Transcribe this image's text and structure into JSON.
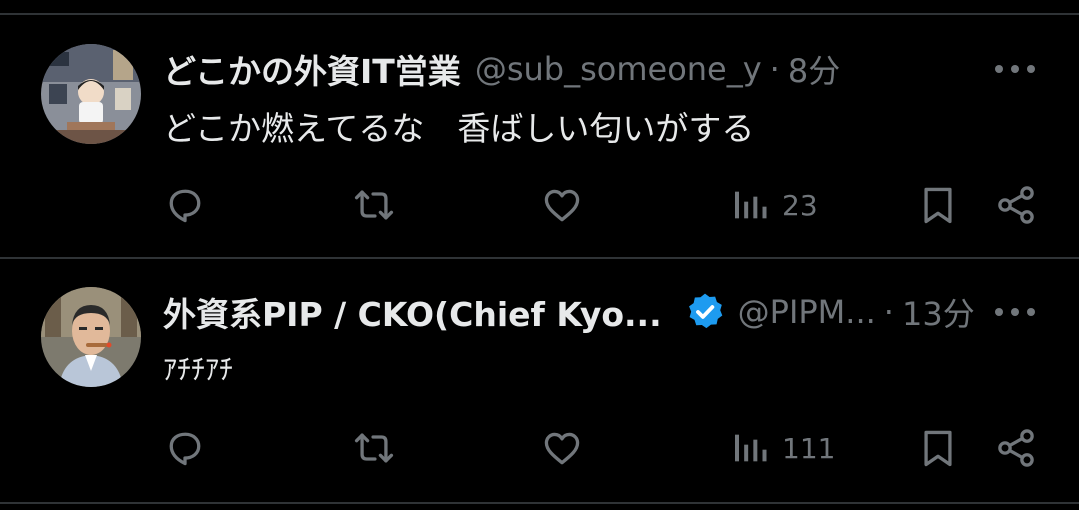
{
  "tweets": [
    {
      "display_name": "どこかの外資IT営業",
      "handle": "@sub_someone_y",
      "separator": "·",
      "time": "8分",
      "text": "どこか燃えてるな　香ばしい匂いがする",
      "views": "23",
      "verified": false
    },
    {
      "display_name": "外資系PIP / CKO(Chief Kyo...",
      "handle": "@PIPM...",
      "separator": "·",
      "time": "13分",
      "text": "ｱﾁﾁｱﾁ",
      "views": "111",
      "verified": true
    }
  ],
  "colors": {
    "background": "#000000",
    "primary_text": "#e7e9ea",
    "secondary_text": "#71767b",
    "divider": "#2f3336",
    "verified_blue": "#1d9bf0"
  },
  "icons": [
    "reply-icon",
    "retweet-icon",
    "like-icon",
    "views-icon",
    "bookmark-icon",
    "share-icon",
    "more-icon",
    "verified-icon"
  ]
}
